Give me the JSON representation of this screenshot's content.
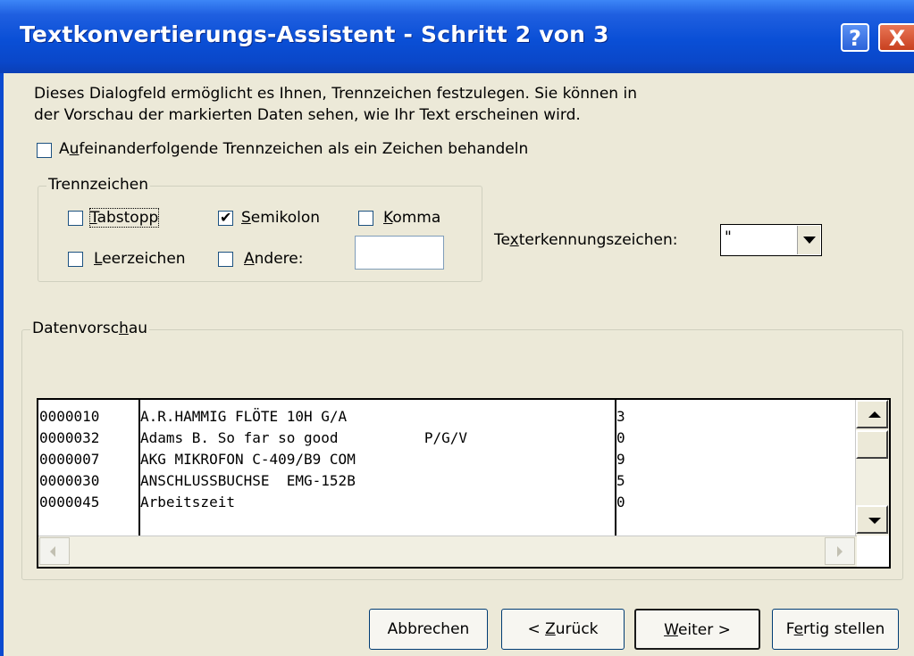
{
  "window": {
    "title": "Textkonvertierungs-Assistent - Schritt 2 von 3",
    "help_glyph": "?",
    "close_glyph": "X"
  },
  "description": {
    "line1": "Dieses Dialogfeld ermöglicht es Ihnen, Trennzeichen festzulegen. Sie können in",
    "line2": "der Vorschau der markierten Daten sehen, wie Ihr Text erscheinen wird."
  },
  "consecutive": {
    "label_before": "A",
    "label_accel": "u",
    "label_after": "feinanderfolgende Trennzeichen als ein Zeichen behandeln",
    "checked": false
  },
  "delimiters": {
    "legend": "Trennzeichen",
    "tab": {
      "accel": "T",
      "rest": "abstopp",
      "checked": false
    },
    "semicolon": {
      "accel": "S",
      "rest": "emikolon",
      "checked": true,
      "mark": "✔"
    },
    "comma": {
      "accel": "K",
      "rest": "omma",
      "checked": false
    },
    "space": {
      "accel": "L",
      "rest": "eerzeichen",
      "checked": false
    },
    "other": {
      "accel": "A",
      "rest": "ndere:",
      "checked": false,
      "value": ""
    }
  },
  "text_qualifier": {
    "label_before": "Te",
    "label_accel": "x",
    "label_after": "terkennungszeichen:",
    "value": "\""
  },
  "preview": {
    "legend_before": "Datenvorsc",
    "legend_accel": "h",
    "legend_after": "au",
    "rows": [
      {
        "c1": "0000010",
        "c2": "A.R.HAMMIG FLÖTE 10H G/A",
        "c3": "3"
      },
      {
        "c1": "0000032",
        "c2": "Adams B. So far so good          P/G/V",
        "c3": "0"
      },
      {
        "c1": "0000007",
        "c2": "AKG MIKROFON C-409/B9 COM",
        "c3": "9"
      },
      {
        "c1": "0000030",
        "c2": "ANSCHLUSSBUCHSE  EMG-152B",
        "c3": "5"
      },
      {
        "c1": "0000045",
        "c2": "Arbeitszeit",
        "c3": "0"
      }
    ]
  },
  "buttons": {
    "cancel": "Abbrechen",
    "back_before": "< ",
    "back_accel": "Z",
    "back_after": "urück",
    "next_accel": "W",
    "next_after": "eiter >",
    "finish_before": "F",
    "finish_accel": "e",
    "finish_after": "rtig stellen"
  }
}
